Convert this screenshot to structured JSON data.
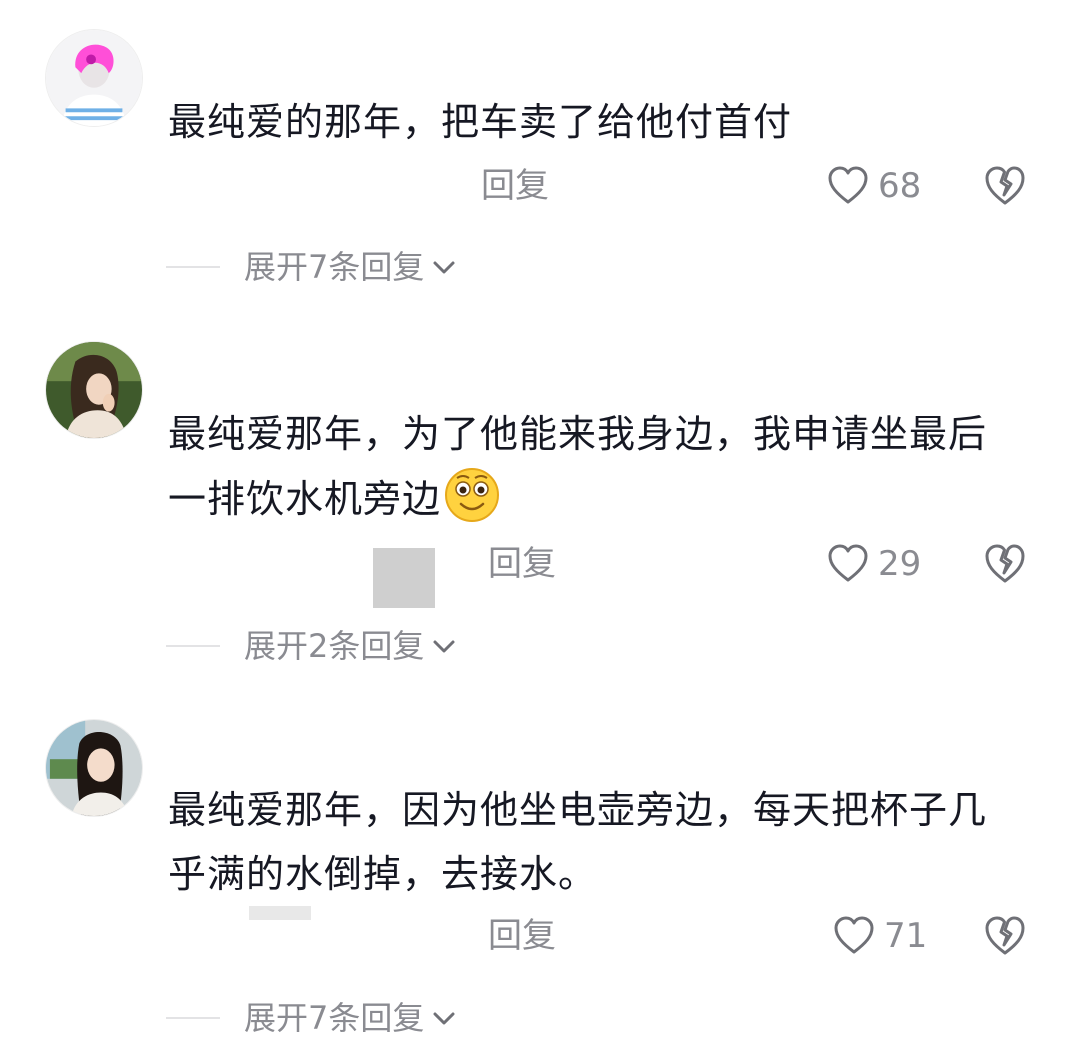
{
  "comments": [
    {
      "avatar_icon": "avatar-pink-hair",
      "text": "最纯爱的那年，把车卖了给他付首付",
      "reply_label": "回复",
      "like_count": "68",
      "expand_label": "展开7条回复"
    },
    {
      "avatar_icon": "avatar-girl-photo",
      "text_line1": "最纯爱那年，为了他能来我身边，我申请坐最后",
      "text_line2": "一排饮水机旁边",
      "emoji_icon": "smile-emoji-icon",
      "reply_label": "回复",
      "like_count": "29",
      "expand_label": "展开2条回复"
    },
    {
      "avatar_icon": "avatar-girl-car-photo",
      "text_line1": "最纯爱那年，因为他坐电壶旁边，每天把杯子几",
      "text_line2": "乎满的水倒掉，去接水。",
      "reply_label": "回复",
      "like_count": "71",
      "expand_label": "展开7条回复"
    }
  ],
  "colors": {
    "text_primary": "#161823",
    "text_secondary": "#8a8b91",
    "divider": "#e3e3e5",
    "icon_stroke": "#6f7076"
  }
}
